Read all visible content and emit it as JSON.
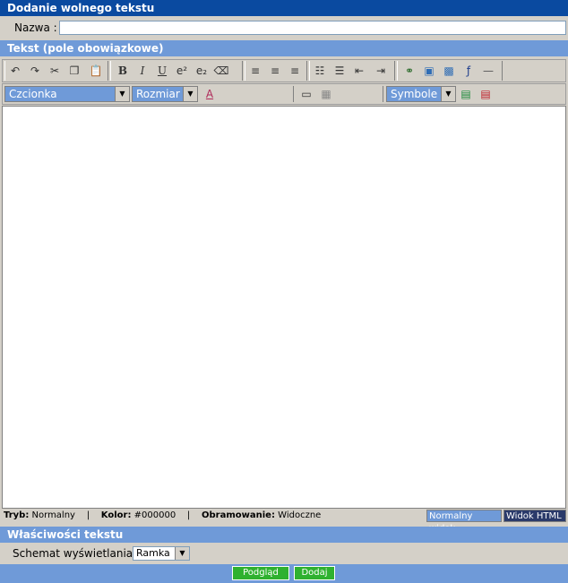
{
  "header": {
    "title": "Dodanie wolnego tekstu"
  },
  "name_row": {
    "label": "Nazwa :",
    "value": ""
  },
  "text_section": {
    "title": "Tekst (pole obowiązkowe)"
  },
  "toolbar_row1": {
    "groups": [
      {
        "icons": [
          "undo-icon",
          "redo-icon",
          "cut-icon",
          "copy-icon",
          "paste-icon"
        ]
      },
      {
        "icons": [
          "bold-icon",
          "italic-icon",
          "underline-icon",
          "superscript-icon",
          "subscript-icon",
          "eraser-icon"
        ]
      },
      {
        "icons": [
          "align-left-icon",
          "align-center-icon",
          "align-right-icon"
        ]
      },
      {
        "icons": [
          "ordered-list-icon",
          "unordered-list-icon",
          "outdent-icon",
          "indent-icon"
        ]
      },
      {
        "icons": [
          "link-icon",
          "image-icon",
          "gallery-icon",
          "flash-icon",
          "horizontal-rule-icon"
        ]
      }
    ],
    "bold": "B",
    "italic": "I",
    "underline": "U",
    "sup": "e²",
    "sub": "e₂"
  },
  "toolbar_row2": {
    "font_select": "Czcionka",
    "size_select": "Rozmiar",
    "symbols_select": "Symbole"
  },
  "status_bar": {
    "mode_label": "Tryb:",
    "mode_value": "Normalny",
    "color_label": "Kolor:",
    "color_value": "#000000",
    "border_label": "Obramowanie:",
    "border_value": "Widoczne",
    "separator": "|",
    "normal_view": "Normalny widok",
    "html_view": "Widok HTML"
  },
  "properties": {
    "title": "Właściwości tekstu",
    "schema_label": "Schemat wyświetlania :",
    "schema_value": "Ramka"
  },
  "footer": {
    "preview": "Podgląd",
    "add": "Dodaj"
  },
  "colors": {
    "dark_bar": "#0a4aa0",
    "light_bar": "#6f9ad8",
    "green_button": "#2fb12f"
  }
}
